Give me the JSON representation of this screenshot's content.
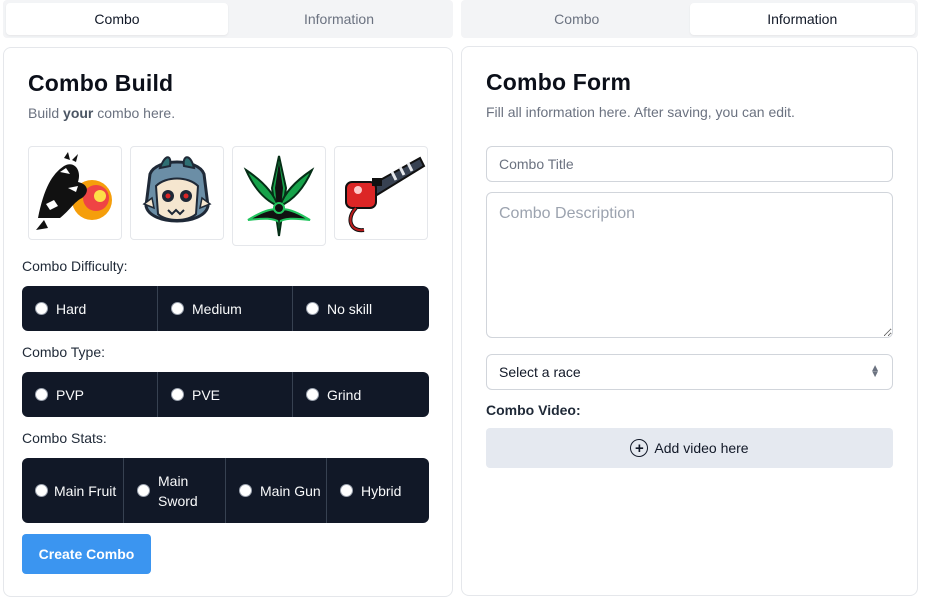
{
  "left_tabs": {
    "combo": "Combo",
    "information": "Information",
    "active": "combo"
  },
  "right_tabs": {
    "combo": "Combo",
    "information": "Information",
    "active": "information"
  },
  "combo_build": {
    "title": "Combo Build",
    "subtitle_before": "Build ",
    "subtitle_bold": "your",
    "subtitle_after": " combo here.",
    "items": [
      {
        "icon": "dragon-fruit-icon"
      },
      {
        "icon": "skull-beast-icon"
      },
      {
        "icon": "dark-sword-icon"
      },
      {
        "icon": "bazooka-gun-icon"
      }
    ],
    "difficulty": {
      "label": "Combo Difficulty:",
      "options": [
        "Hard",
        "Medium",
        "No skill"
      ]
    },
    "type": {
      "label": "Combo Type:",
      "options": [
        "PVP",
        "PVE",
        "Grind"
      ]
    },
    "stats": {
      "label": "Combo Stats:",
      "options": [
        "Main Fruit",
        "Main Sword",
        "Main Gun",
        "Hybrid"
      ]
    },
    "create_button": "Create Combo"
  },
  "combo_form": {
    "title": "Combo Form",
    "subtitle": "Fill all information here. After saving, you can edit.",
    "title_placeholder": "Combo Title",
    "description_placeholder": "Combo Description",
    "race_select": "Select a race",
    "video_label": "Combo Video:",
    "video_button": "Add video here"
  },
  "colors": {
    "primary_button": "#3b95f0",
    "radio_group_bg": "#111827",
    "video_button_bg": "#e5e9f0"
  }
}
